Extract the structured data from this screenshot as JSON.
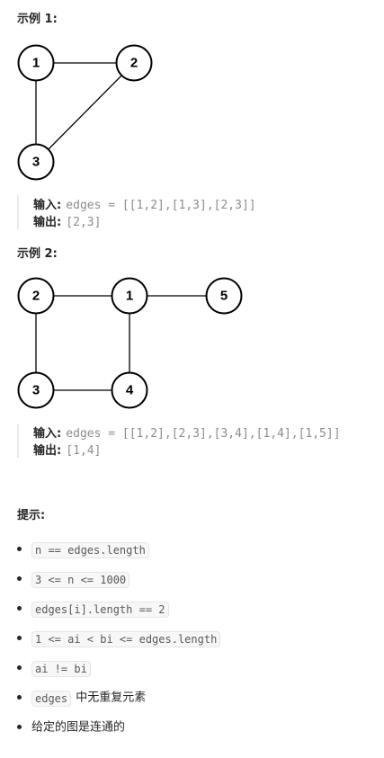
{
  "example1": {
    "title": "示例 1:",
    "nodes": [
      "1",
      "2",
      "3"
    ],
    "input_label": "输入:",
    "input_value": "edges = [[1,2],[1,3],[2,3]]",
    "output_label": "输出:",
    "output_value": "[2,3]"
  },
  "example2": {
    "title": "示例 2:",
    "nodes": [
      "1",
      "2",
      "3",
      "4",
      "5"
    ],
    "input_label": "输入:",
    "input_value": "edges = [[1,2],[2,3],[3,4],[1,4],[1,5]]",
    "output_label": "输出:",
    "output_value": "[1,4]"
  },
  "hints": {
    "title": "提示:",
    "items": [
      {
        "code": "n == edges.length",
        "text": ""
      },
      {
        "code": "3 <= n <= 1000",
        "text": ""
      },
      {
        "code": "edges[i].length == 2",
        "text": ""
      },
      {
        "code": "1 <= ai < bi <= edges.length",
        "text": ""
      },
      {
        "code": "ai != bi",
        "text": ""
      },
      {
        "code": "edges",
        "text": "中无重复元素"
      },
      {
        "code": "",
        "text": "给定的图是连通的"
      }
    ]
  }
}
